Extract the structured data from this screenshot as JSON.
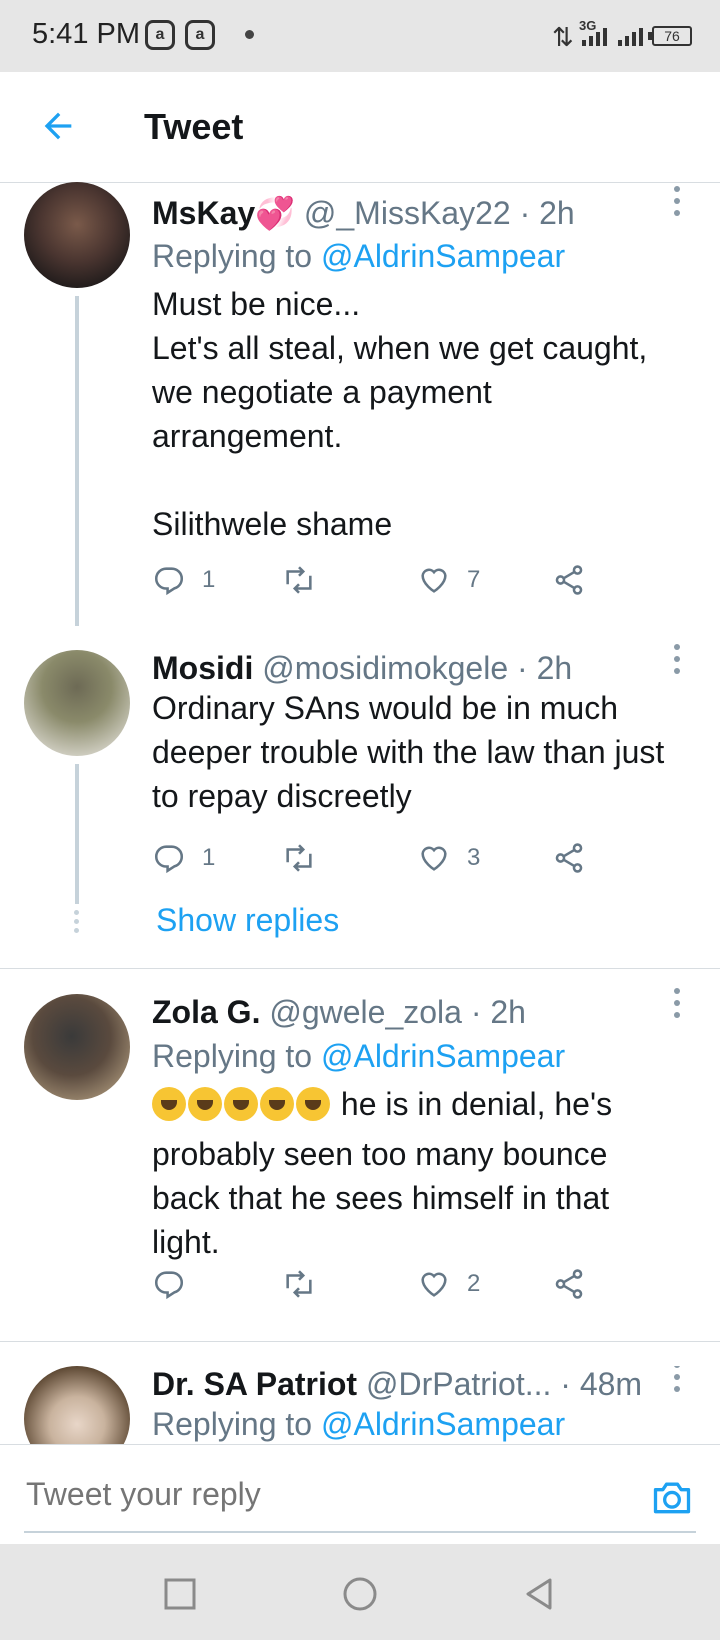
{
  "status_bar": {
    "time": "5:41 PM",
    "network": "3G",
    "battery": "76"
  },
  "header": {
    "title": "Tweet"
  },
  "tweets": [
    {
      "name": "MsKay💞",
      "handle": "@_MissKay22",
      "time": "· 2h",
      "replying_prefix": "Replying to ",
      "replying_handle": "@AldrinSampear",
      "lines": [
        "Must be nice...",
        "Let's all steal, when we get caught, we negotiate a payment arrangement.",
        "",
        "Silithwele shame"
      ],
      "replies": "1",
      "retweets": "",
      "likes": "7"
    },
    {
      "name": "Mosidi",
      "handle": "@mosidimokgele",
      "time": "· 2h",
      "lines": [
        "Ordinary SAns would be in much deeper trouble with the law than just to repay discreetly"
      ],
      "replies": "1",
      "retweets": "",
      "likes": "3"
    },
    {
      "name": "Zola G.",
      "handle": "@gwele_zola",
      "time": "· 2h",
      "replying_prefix": "Replying to ",
      "replying_handle": "@AldrinSampear",
      "text": " he is in denial, he's probably seen too many bounce back that he sees himself in that light.",
      "replies": "",
      "retweets": "",
      "likes": "2"
    },
    {
      "name": "Dr. SA Patriot",
      "handle": "@DrPatriot...",
      "time": "· 48m",
      "replying_prefix": "Replying to ",
      "replying_handle": "@AldrinSampear"
    }
  ],
  "show_replies": "Show replies",
  "reply_box": {
    "placeholder": "Tweet your reply"
  },
  "colors": {
    "accent": "#1da1f2",
    "muted": "#657786",
    "text": "#14171a"
  }
}
